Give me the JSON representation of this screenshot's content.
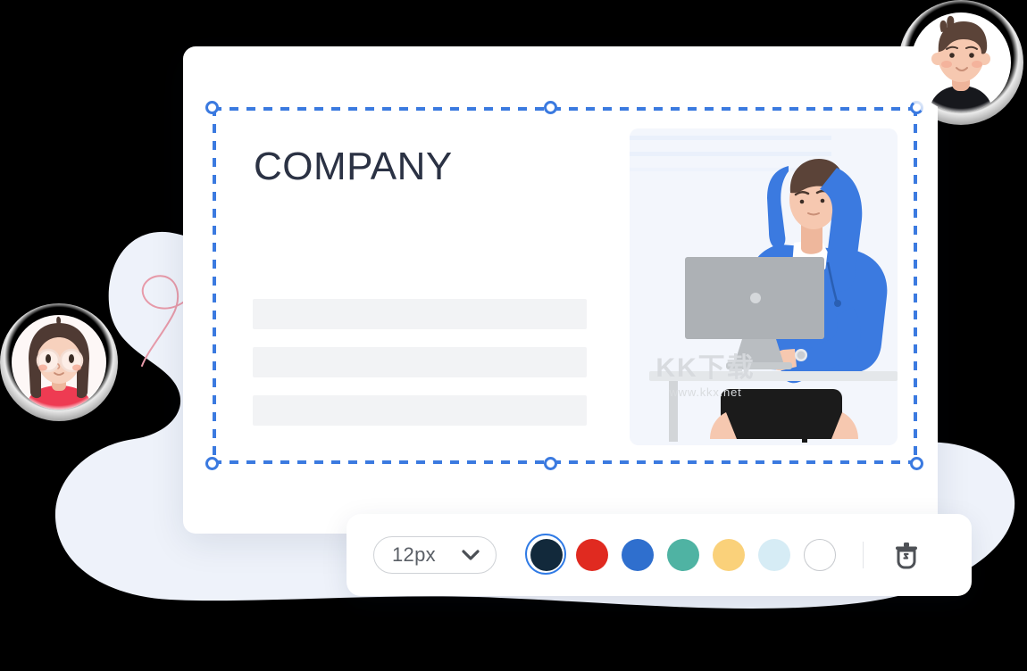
{
  "canvas": {
    "background_color": "#000000",
    "blob_color": "#eef2fa"
  },
  "card": {
    "title": "COMPANY",
    "title_color": "#2b3244",
    "background_color": "#ffffff",
    "placeholder_bars": [
      {
        "name": "text-line-1"
      },
      {
        "name": "text-line-2"
      },
      {
        "name": "text-line-3"
      }
    ],
    "illustration": {
      "name": "person-at-computer-illustration",
      "panel_color": "#f3f6fc",
      "hoodie_color": "#3b7ae0",
      "monitor_color": "#a9adb1",
      "desk_color": "#e8eaec",
      "shorts_color": "#1b1b1b"
    }
  },
  "watermark": {
    "text_cn": "KK下载",
    "text_url": "www.kkx.net",
    "color": "#d7dade"
  },
  "selection": {
    "name": "selection-box",
    "stroke_color": "#3b7ae0",
    "style": "dashed",
    "handles": [
      {
        "name": "handle-top-left"
      },
      {
        "name": "handle-top-center"
      },
      {
        "name": "handle-top-right"
      },
      {
        "name": "handle-bottom-left"
      },
      {
        "name": "handle-bottom-center"
      },
      {
        "name": "handle-bottom-right"
      }
    ]
  },
  "toolbar": {
    "font_size_select": {
      "value": "12px",
      "placeholder": "12px",
      "icon": "chevron-down-icon",
      "options": [
        "12px"
      ]
    },
    "color_swatches": [
      {
        "name": "swatch-dark-navy",
        "hex": "#12293b",
        "selected": true,
        "outlined": false
      },
      {
        "name": "swatch-red",
        "hex": "#e02a20",
        "selected": false,
        "outlined": false
      },
      {
        "name": "swatch-blue",
        "hex": "#2f6fce",
        "selected": false,
        "outlined": false
      },
      {
        "name": "swatch-teal",
        "hex": "#4fb3a3",
        "selected": false,
        "outlined": false
      },
      {
        "name": "swatch-yellow",
        "hex": "#fad17a",
        "selected": false,
        "outlined": false
      },
      {
        "name": "swatch-light-blue",
        "hex": "#d6ecf5",
        "selected": false,
        "outlined": false
      },
      {
        "name": "swatch-white",
        "hex": "#ffffff",
        "selected": false,
        "outlined": true
      }
    ],
    "delete_button": {
      "icon": "trash-icon",
      "color": "#4e5156"
    }
  },
  "avatars": [
    {
      "name": "avatar-top-right",
      "description": "male-avatar",
      "hair_color": "#5b4338",
      "skin_color": "#f6c8b0",
      "shirt_color": "#17181d"
    },
    {
      "name": "avatar-bottom-left",
      "description": "female-avatar-with-glasses",
      "hair_color": "#4f3a33",
      "skin_color": "#f7d1bd",
      "shirt_color": "#ee3b52"
    }
  ],
  "decorations": [
    {
      "name": "blue-swirl-decoration",
      "color": "#9db7e8"
    },
    {
      "name": "pink-swirl-decoration",
      "color": "#e79aa9"
    }
  ]
}
